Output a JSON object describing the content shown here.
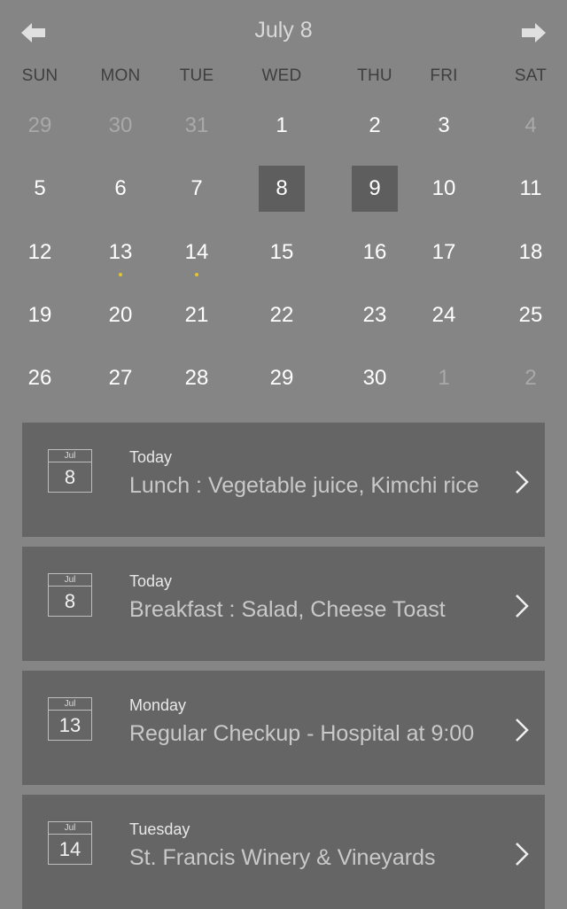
{
  "header": {
    "title": "July 8"
  },
  "weekdays": [
    "SUN",
    "MON",
    "TUE",
    "WED",
    "THU",
    "FRI",
    "SAT"
  ],
  "calendar": {
    "weeks": [
      [
        {
          "d": "29",
          "dim": true
        },
        {
          "d": "30",
          "dim": true
        },
        {
          "d": "31",
          "dim": true
        },
        {
          "d": "1"
        },
        {
          "d": "2"
        },
        {
          "d": "3"
        },
        {
          "d": "4",
          "dim": true
        }
      ],
      [
        {
          "d": "5"
        },
        {
          "d": "6"
        },
        {
          "d": "7"
        },
        {
          "d": "8",
          "selected": true
        },
        {
          "d": "9",
          "selected": true
        },
        {
          "d": "10"
        },
        {
          "d": "11"
        }
      ],
      [
        {
          "d": "12"
        },
        {
          "d": "13",
          "dot": true
        },
        {
          "d": "14",
          "dot": true
        },
        {
          "d": "15"
        },
        {
          "d": "16"
        },
        {
          "d": "17"
        },
        {
          "d": "18"
        }
      ],
      [
        {
          "d": "19"
        },
        {
          "d": "20"
        },
        {
          "d": "21"
        },
        {
          "d": "22"
        },
        {
          "d": "23"
        },
        {
          "d": "24"
        },
        {
          "d": "25"
        }
      ],
      [
        {
          "d": "26"
        },
        {
          "d": "27"
        },
        {
          "d": "28"
        },
        {
          "d": "29"
        },
        {
          "d": "30"
        },
        {
          "d": "1",
          "dim": true
        },
        {
          "d": "2",
          "dim": true
        }
      ]
    ],
    "dot_color": "#e2c431"
  },
  "events": [
    {
      "month": "Jul",
      "day": "8",
      "label": "Today",
      "title": "Lunch : Vegetable juice, Kimchi rice"
    },
    {
      "month": "Jul",
      "day": "8",
      "label": "Today",
      "title": "Breakfast : Salad, Cheese Toast"
    },
    {
      "month": "Jul",
      "day": "13",
      "label": "Monday",
      "title": "Regular Checkup - Hospital at 9:00"
    },
    {
      "month": "Jul",
      "day": "14",
      "label": "Tuesday",
      "title": "St. Francis Winery & Vineyards"
    }
  ],
  "icons": {
    "prev": "arrow-left-icon",
    "next": "arrow-right-icon",
    "event_calendar": "calendar-icon",
    "event_open": "chevron-right-icon"
  },
  "colors": {
    "background": "#858585",
    "event_card": "#656565",
    "selected_day": "#5e5e5e"
  }
}
